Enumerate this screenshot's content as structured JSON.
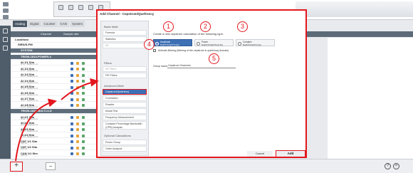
{
  "mode_tabs": [
    "Analog",
    "Digital",
    "Counter",
    "CAN",
    "System"
  ],
  "grid_headers": [
    "Channel",
    "Sample rate"
  ],
  "tree": {
    "root": "Localhost",
    "device": "SIRIUS-PM",
    "rows": [
      {
        "name": "SYSTEM",
        "group": true
      },
      {
        "name": "TRION-1810-POWER-4",
        "group": true
      },
      {
        "name": "AI 1/1 Sim",
        "sub": "AI 1/1 - Module AI 1.0"
      },
      {
        "name": "AI 1/2 Sim",
        "sub": "AI 1/2 - Module AI 1.0"
      },
      {
        "name": "AI 1/3 Sim",
        "sub": "AI 1/3 - Module AI 1.0"
      },
      {
        "name": "AI 1/4 Sim",
        "sub": "AI 1/4 - Module AI 1.0"
      },
      {
        "name": "AI 1/5 Sim",
        "sub": "AI 1/5 - Module AI 1.0"
      },
      {
        "name": "AI 1/6 Sim",
        "sub": "AI 1/6 - Module AI 1.0"
      },
      {
        "name": "AI 1/7 Sim",
        "sub": "AI 1/7 - Module AI 1.0"
      },
      {
        "name": "AI 1/8 Sim",
        "sub": "AI 1/8 - Module AI 1.0"
      },
      {
        "name": "TRION-1820-MULTI-4-D",
        "group": true
      },
      {
        "name": "AI 2/1 Sim",
        "sub": "AI 2/1 - Module AI 2.0"
      },
      {
        "name": "AI 2/2 Sim",
        "sub": "AI 2/2 - Module AI 2.0"
      },
      {
        "name": "AI 2/3 Sim",
        "sub": "AI 2/3 - Module AI 2.0"
      },
      {
        "name": "AI 2/4 Sim",
        "sub": "AI 2/4 - Module AI 2.0"
      },
      {
        "name": "CNT 1/1 Sim",
        "sub": "CNT 1/1"
      },
      {
        "name": "CNT 1/2 Sim",
        "sub": "CNT 1/2"
      },
      {
        "name": "CAN 1/1 Sim",
        "sub": "CAN 1/1"
      }
    ]
  },
  "dialog": {
    "title": "Add Channel - Cepstrum/Quefrency",
    "sections": [
      {
        "title": "Basic Math",
        "items": [
          {
            "label": "Formula",
            "state": "normal"
          },
          {
            "label": "Statistics",
            "state": "normal"
          },
          {
            "label": "IIR",
            "state": "disabled"
          }
        ]
      },
      {
        "title": "Filters",
        "items": [
          {
            "label": "IIR Filters",
            "state": "disabled"
          },
          {
            "label": "FIR Filters",
            "state": "normal"
          }
        ]
      },
      {
        "title": "Advanced Math",
        "items": [
          {
            "label": "Cepstrum/Quefrency",
            "state": "selected"
          },
          {
            "label": "Correlation",
            "state": "normal"
          },
          {
            "label": "Rosette",
            "state": "normal"
          },
          {
            "label": "Modal Test",
            "state": "normal"
          },
          {
            "label": "Frequency Measurement",
            "state": "normal"
          },
          {
            "label": "Constant Percentage Bandwidth (CPB) Analysis",
            "state": "normal"
          }
        ]
      },
      {
        "title": "Optional Calculations",
        "items": [
          {
            "label": "Power Group",
            "state": "normal"
          },
          {
            "label": "Order Analysis",
            "state": "normal"
          }
        ]
      }
    ],
    "prompt": "Create a new cepstrum calculation of the following type:",
    "types": [
      {
        "label": "Amplitude",
        "formula": "Re(IFFT(ln(|FFT(x)|)))",
        "active": true
      },
      {
        "label": "Power",
        "formula": "Re(IFFT(ln(|FFT(x)|^2)))",
        "active": false
      },
      {
        "label": "Complex",
        "formula": "Re(IFFT(ln(FFT(x))))",
        "active": false
      }
    ],
    "liftering_label": "Activate liftering (filtering of the cepstrum in quefrency domain)",
    "group_name_label": "Group name:",
    "group_name_value": "Cepstrum Channels",
    "callouts": [
      "1",
      "2",
      "3",
      "4",
      "5"
    ],
    "cancel_label": "Cancel",
    "add_label": "Add"
  },
  "bottom": {
    "add_symbol": "+",
    "remove_symbol": "−",
    "help_symbol": "?",
    "close_symbol": "×"
  },
  "colors": {
    "highlight_red": "#e3171e",
    "selected_blue": "#3d6fb5",
    "header_gray": "#5d6b79"
  }
}
